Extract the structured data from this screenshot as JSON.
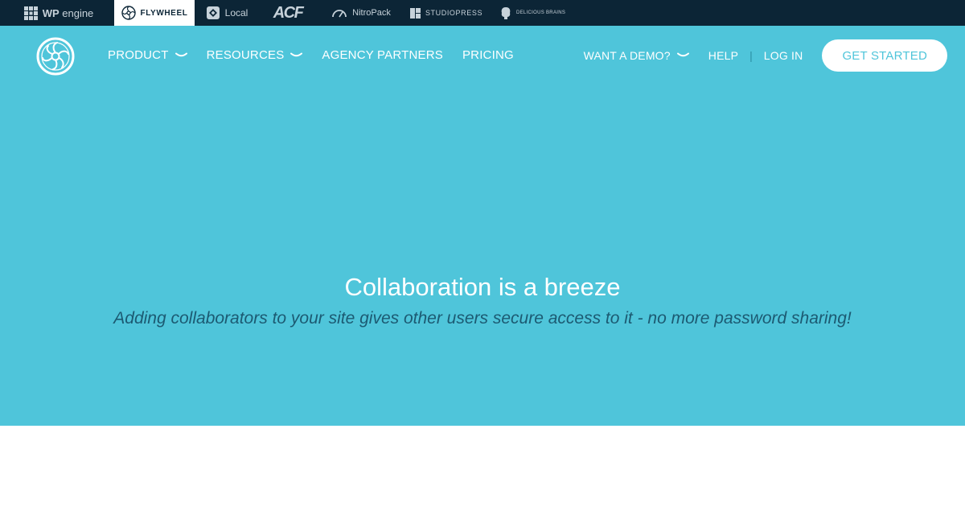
{
  "brand_bar": {
    "items": [
      {
        "label_bold": "WP",
        "label": " engine",
        "icon": "wpengine-grid-icon"
      },
      {
        "label": "FLYWHEEL",
        "icon": "flywheel-icon",
        "active": true
      },
      {
        "label": "Local",
        "icon": "local-icon"
      },
      {
        "label": "ACF",
        "icon": "acf-wordmark"
      },
      {
        "label": "NitroPack",
        "icon": "nitropack-gauge-icon"
      },
      {
        "label": "STUDIOPRESS",
        "icon": "studiopress-icon"
      },
      {
        "label": "Delicious Brains",
        "icon": "delicious-brains-icon"
      }
    ]
  },
  "header": {
    "nav_left": [
      "PRODUCT",
      "RESOURCES",
      "AGENCY PARTNERS",
      "PRICING"
    ],
    "nav_right": {
      "demo": "WANT A DEMO?",
      "help": "HELP",
      "separator": "|",
      "login": "LOG IN",
      "cta": "GET STARTED"
    }
  },
  "hero": {
    "title": "Collaboration is a breeze",
    "subtitle": "Adding collaborators to your site gives other users secure access to it - no more password sharing!"
  },
  "colors": {
    "brand_bar_bg": "#0c2536",
    "hero_bg": "#4fc5da",
    "cta_text": "#4fc5da",
    "subtitle_text": "#1c5a72"
  }
}
